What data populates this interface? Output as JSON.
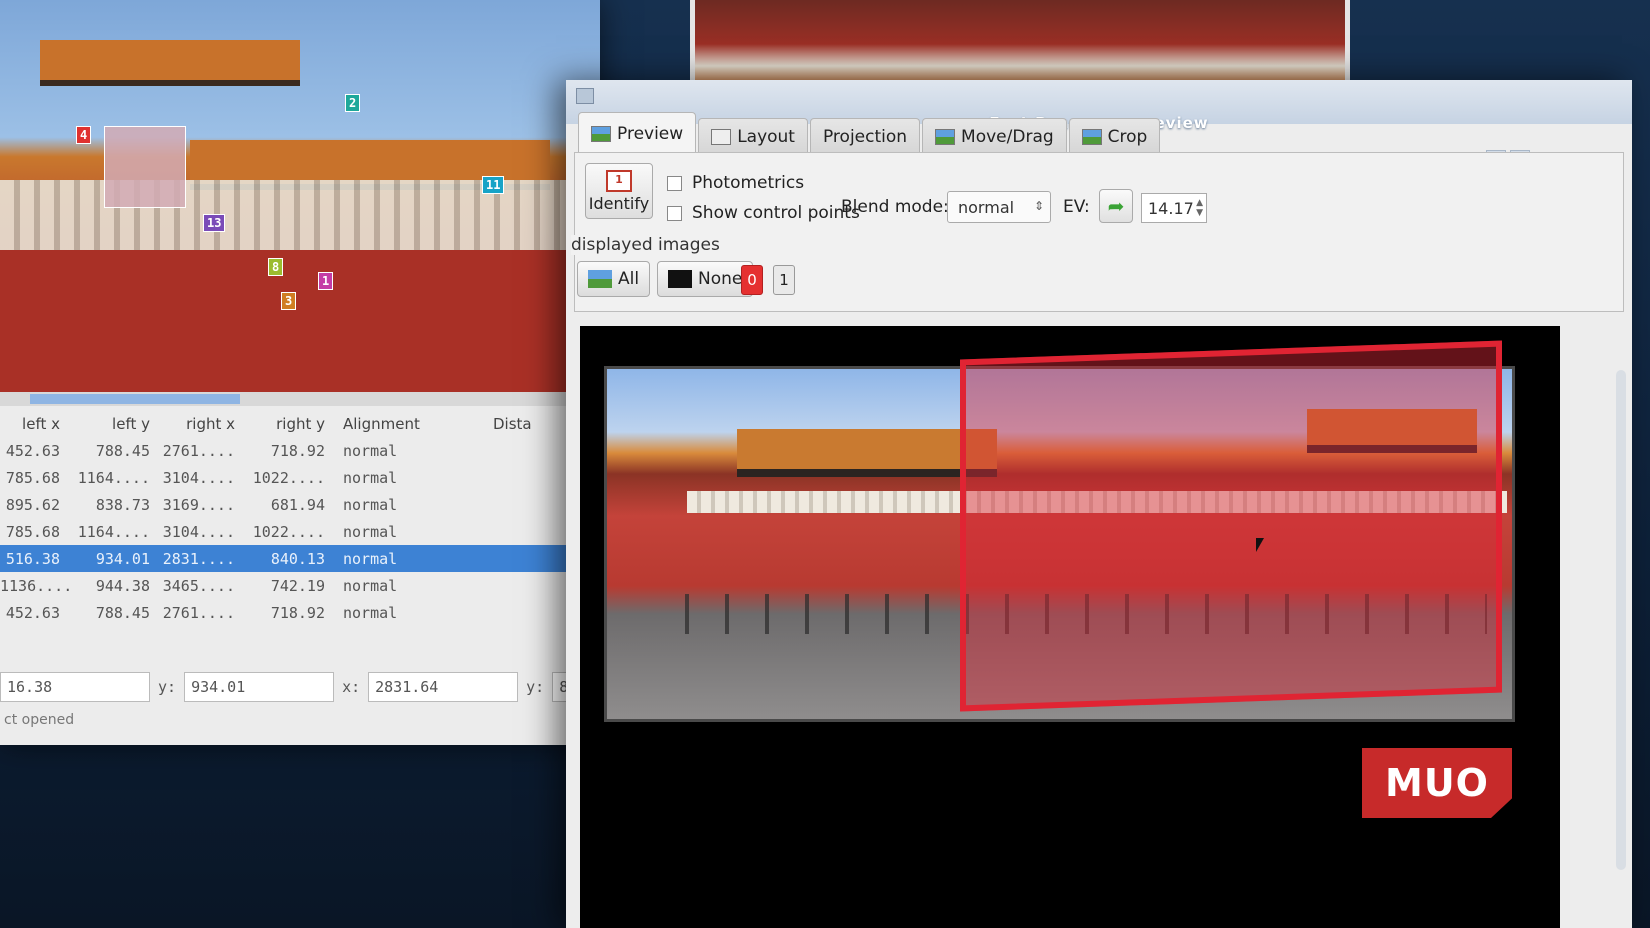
{
  "colors": {
    "accent": "#3d82d4",
    "overlay_red": "#e02433",
    "brand_red": "#c72a2a"
  },
  "cp_editor": {
    "markers": [
      "2",
      "4",
      "11",
      "13",
      "8",
      "3",
      "1"
    ],
    "table": {
      "headers": [
        "left x",
        "left y",
        "right x",
        "right y",
        "Alignment",
        "Dista"
      ],
      "rows": [
        [
          "452.63",
          "788.45",
          "2761....",
          "718.92",
          "normal"
        ],
        [
          "785.68",
          "1164....",
          "3104....",
          "1022....",
          "normal"
        ],
        [
          "895.62",
          "838.73",
          "3169....",
          "681.94",
          "normal"
        ],
        [
          "785.68",
          "1164....",
          "3104....",
          "1022....",
          "normal"
        ],
        [
          "516.38",
          "934.01",
          "2831....",
          "840.13",
          "normal"
        ],
        [
          "1136....",
          "944.38",
          "3465....",
          "742.19",
          "normal"
        ],
        [
          "452.63",
          "788.45",
          "2761....",
          "718.92",
          "normal"
        ]
      ],
      "selected_row": 4
    },
    "inputs": {
      "x_left": "16.38",
      "y_label": "y:",
      "y_left": "934.01",
      "x_label": "x:",
      "x_right": "2831.64",
      "y2_label": "y:",
      "y_right": "8"
    },
    "status": "ct opened"
  },
  "preview": {
    "title": "Fast Panorama preview",
    "tabs": [
      "Preview",
      "Layout",
      "Projection",
      "Move/Drag",
      "Crop"
    ],
    "active_tab": 0,
    "identify_label": "Identify",
    "identify_icon_text": "1",
    "photometrics_label": "Photometrics",
    "show_cp_label": "Show control points",
    "blend_label": "Blend mode:",
    "blend_value": "normal",
    "ev_label": "EV:",
    "ev_value": "14.17",
    "displayed_images_label": "displayed images",
    "all_label": "All",
    "none_label": "None",
    "image_buttons": [
      "0",
      "1"
    ]
  },
  "watermark": {
    "text": "MUO"
  }
}
